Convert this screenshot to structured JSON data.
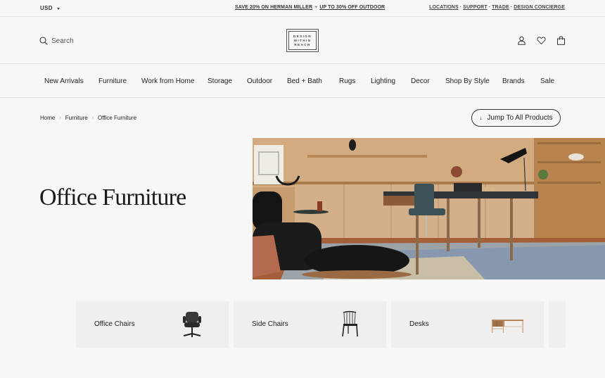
{
  "topbar": {
    "currency": "USD",
    "promo": {
      "offer1": "SAVE 20% ON HERMAN MILLER",
      "separator": "+",
      "offer2": "UP TO 30% OFF OUTDOOR"
    },
    "utility_links": [
      "LOCATIONS",
      "SUPPORT",
      "TRADE",
      "DESIGN CONCIERGE"
    ],
    "utility_separator": "·"
  },
  "header": {
    "search_label": "Search",
    "logo_lines": [
      "DESIGN",
      "WITHIN",
      "REACH"
    ],
    "icons": [
      "account-icon",
      "wishlist-heart-icon",
      "shopping-bag-icon"
    ]
  },
  "nav": {
    "items": [
      {
        "label": "New Arrivals"
      },
      {
        "label": "Furniture"
      },
      {
        "label": "Work from Home"
      },
      {
        "label": "Storage"
      },
      {
        "label": "Outdoor"
      },
      {
        "label": "Bed + Bath"
      },
      {
        "label": "Rugs"
      },
      {
        "label": "Lighting"
      },
      {
        "label": "Decor"
      },
      {
        "label": "Shop By Style"
      },
      {
        "label": "Brands"
      },
      {
        "label": "Sale"
      }
    ]
  },
  "breadcrumb": {
    "items": [
      "Home",
      "Furniture",
      "Office Furniture"
    ],
    "separator": "›"
  },
  "jump_button": {
    "icon": "↓",
    "label": "Jump To All Products"
  },
  "hero": {
    "title": "Office Furniture",
    "image_alt": "Home office with lounge chair, ottoman, desk, task chair, lamp and wooden shelving"
  },
  "categories": [
    {
      "label": "Office Chairs",
      "thumb": "office-chair"
    },
    {
      "label": "Side Chairs",
      "thumb": "side-chair"
    },
    {
      "label": "Desks",
      "thumb": "desk"
    },
    {
      "label": "",
      "thumb": ""
    }
  ],
  "colors": {
    "background": "#f7f7f7",
    "card": "#efefef",
    "text": "#222222",
    "border": "#e2e2e2"
  }
}
